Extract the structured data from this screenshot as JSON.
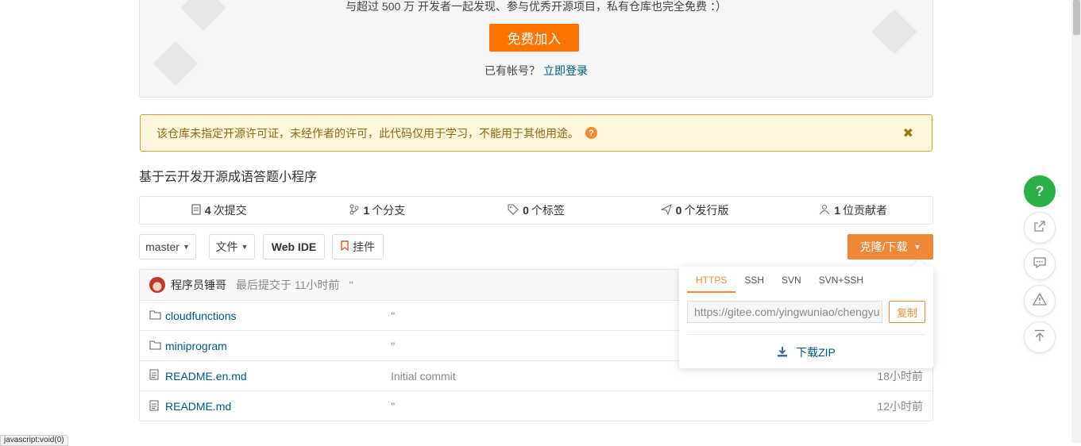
{
  "banner": {
    "subtitle": "与超过 500 万 开发者一起发现、参与优秀开源项目，私有仓库也完全免费 ：）",
    "join_label": "免费加入",
    "login_prompt": "已有帐号？",
    "login_link": "立即登录"
  },
  "license_notice": {
    "text": "该仓库未指定开源许可证，未经作者的许可，此代码仅用于学习，不能用于其他用途。",
    "help_icon": "?",
    "close_icon": "✖"
  },
  "repo_description": "基于云开发开源成语答题小程序",
  "stats": [
    {
      "icon": "commit-icon",
      "count": "4",
      "label": "次提交"
    },
    {
      "icon": "branch-icon",
      "count": "1",
      "label": "个分支"
    },
    {
      "icon": "tag-icon",
      "count": "0",
      "label": "个标签"
    },
    {
      "icon": "release-icon",
      "count": "0",
      "label": "个发行版"
    },
    {
      "icon": "contributors-icon",
      "count": "1",
      "label": "位贡献者"
    }
  ],
  "toolbar": {
    "branch": "master",
    "file_menu": "文件",
    "web_ide": "Web IDE",
    "pendant": "挂件",
    "clone_download": "克隆/下载"
  },
  "latest_commit": {
    "author": "程序员锤哥",
    "meta": "最后提交于 11小时前",
    "message": "''"
  },
  "files": [
    {
      "type": "folder",
      "name": "cloudfunctions",
      "message": "''",
      "time": ""
    },
    {
      "type": "folder",
      "name": "miniprogram",
      "message": "''",
      "time": ""
    },
    {
      "type": "file",
      "name": "README.en.md",
      "message": "Initial commit",
      "time": "18小时前"
    },
    {
      "type": "file",
      "name": "README.md",
      "message": "''",
      "time": "12小时前"
    }
  ],
  "clone_popup": {
    "tabs": [
      "HTTPS",
      "SSH",
      "SVN",
      "SVN+SSH"
    ],
    "active_tab": "HTTPS",
    "url": "https://gitee.com/yingwuniao/chengyu",
    "copy_label": "复制",
    "zip_label": "下载ZIP"
  },
  "float_bar": {
    "help_label": "?"
  },
  "status_tip": "javascript:void(0)",
  "colors": {
    "accent_orange": "#fe7300",
    "clone_orange": "#f0883a",
    "link_blue": "#005980",
    "help_green": "#2cae48"
  }
}
